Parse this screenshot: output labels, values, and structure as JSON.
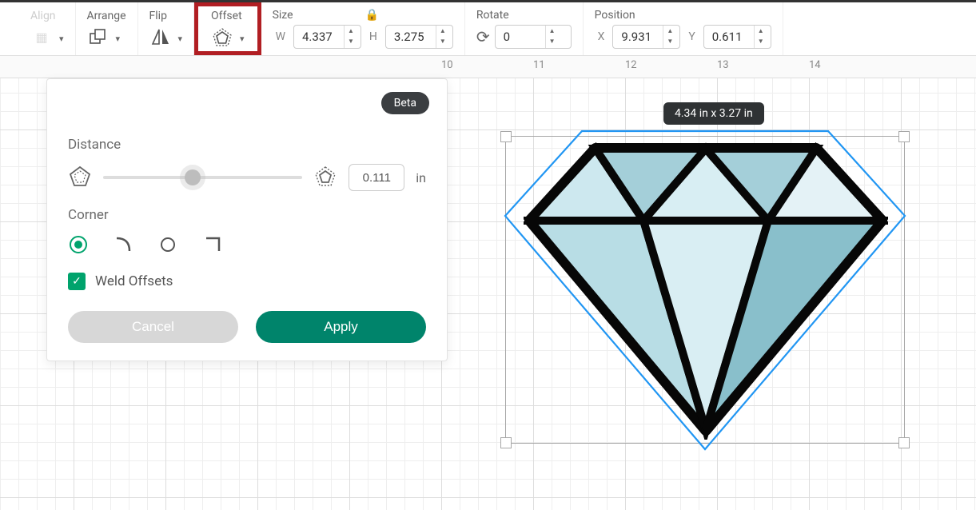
{
  "toolbar": {
    "align_label": "Align",
    "arrange_label": "Arrange",
    "flip_label": "Flip",
    "offset_label": "Offset",
    "size_label": "Size",
    "rotate_label": "Rotate",
    "position_label": "Position",
    "width_prefix": "W",
    "height_prefix": "H",
    "width_value": "4.337",
    "height_value": "3.275",
    "rotate_value": "0",
    "x_prefix": "X",
    "y_prefix": "Y",
    "x_value": "9.931",
    "y_value": "0.611"
  },
  "ruler": {
    "ticks": [
      "10",
      "11",
      "12",
      "13",
      "14"
    ]
  },
  "panel": {
    "beta_label": "Beta",
    "distance_label": "Distance",
    "distance_value": "0.111",
    "distance_unit": "in",
    "corner_label": "Corner",
    "weld_label": "Weld Offsets",
    "weld_checked": true,
    "cancel_label": "Cancel",
    "apply_label": "Apply"
  },
  "selection": {
    "size_badge": "4.34  in x 3.27  in"
  }
}
